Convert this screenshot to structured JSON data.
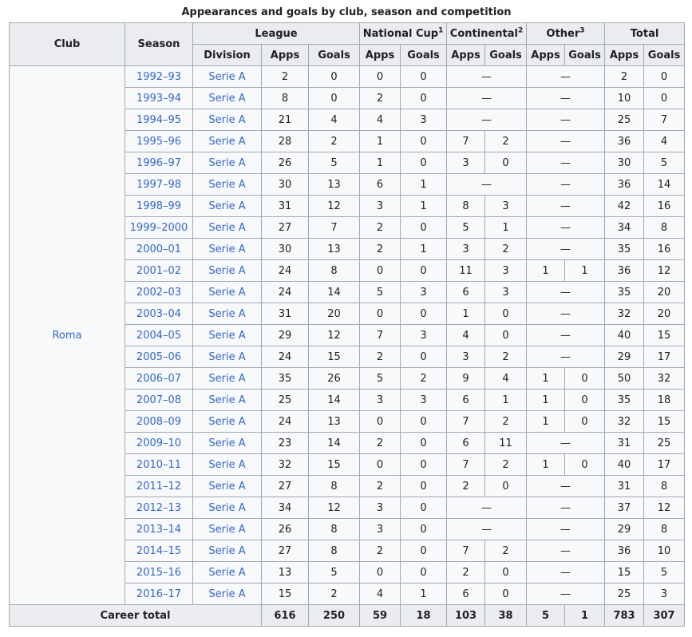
{
  "caption": "Appearances and goals by club, season and competition",
  "headers": {
    "club": "Club",
    "season": "Season",
    "league": "League",
    "national_cup": "National Cup",
    "national_cup_note": "1",
    "continental": "Continental",
    "continental_note": "2",
    "other": "Other",
    "other_note": "3",
    "total": "Total",
    "division": "Division",
    "apps": "Apps",
    "goals": "Goals"
  },
  "club_name": "Roma",
  "dash": "—",
  "rows": [
    {
      "season": "1992–93",
      "division": "Serie A",
      "l_apps": "2",
      "l_goals": "0",
      "c_apps": "0",
      "c_goals": "0",
      "e_apps": null,
      "e_goals": null,
      "o_apps": null,
      "o_goals": null,
      "t_apps": "2",
      "t_goals": "0"
    },
    {
      "season": "1993–94",
      "division": "Serie A",
      "l_apps": "8",
      "l_goals": "0",
      "c_apps": "2",
      "c_goals": "0",
      "e_apps": null,
      "e_goals": null,
      "o_apps": null,
      "o_goals": null,
      "t_apps": "10",
      "t_goals": "0"
    },
    {
      "season": "1994–95",
      "division": "Serie A",
      "l_apps": "21",
      "l_goals": "4",
      "c_apps": "4",
      "c_goals": "3",
      "e_apps": null,
      "e_goals": null,
      "o_apps": null,
      "o_goals": null,
      "t_apps": "25",
      "t_goals": "7"
    },
    {
      "season": "1995–96",
      "division": "Serie A",
      "l_apps": "28",
      "l_goals": "2",
      "c_apps": "1",
      "c_goals": "0",
      "e_apps": "7",
      "e_goals": "2",
      "o_apps": null,
      "o_goals": null,
      "t_apps": "36",
      "t_goals": "4"
    },
    {
      "season": "1996–97",
      "division": "Serie A",
      "l_apps": "26",
      "l_goals": "5",
      "c_apps": "1",
      "c_goals": "0",
      "e_apps": "3",
      "e_goals": "0",
      "o_apps": null,
      "o_goals": null,
      "t_apps": "30",
      "t_goals": "5"
    },
    {
      "season": "1997–98",
      "division": "Serie A",
      "l_apps": "30",
      "l_goals": "13",
      "c_apps": "6",
      "c_goals": "1",
      "e_apps": null,
      "e_goals": null,
      "o_apps": null,
      "o_goals": null,
      "t_apps": "36",
      "t_goals": "14"
    },
    {
      "season": "1998–99",
      "division": "Serie A",
      "l_apps": "31",
      "l_goals": "12",
      "c_apps": "3",
      "c_goals": "1",
      "e_apps": "8",
      "e_goals": "3",
      "o_apps": null,
      "o_goals": null,
      "t_apps": "42",
      "t_goals": "16"
    },
    {
      "season": "1999–2000",
      "division": "Serie A",
      "l_apps": "27",
      "l_goals": "7",
      "c_apps": "2",
      "c_goals": "0",
      "e_apps": "5",
      "e_goals": "1",
      "o_apps": null,
      "o_goals": null,
      "t_apps": "34",
      "t_goals": "8"
    },
    {
      "season": "2000–01",
      "division": "Serie A",
      "l_apps": "30",
      "l_goals": "13",
      "c_apps": "2",
      "c_goals": "1",
      "e_apps": "3",
      "e_goals": "2",
      "o_apps": null,
      "o_goals": null,
      "t_apps": "35",
      "t_goals": "16"
    },
    {
      "season": "2001–02",
      "division": "Serie A",
      "l_apps": "24",
      "l_goals": "8",
      "c_apps": "0",
      "c_goals": "0",
      "e_apps": "11",
      "e_goals": "3",
      "o_apps": "1",
      "o_goals": "1",
      "t_apps": "36",
      "t_goals": "12"
    },
    {
      "season": "2002–03",
      "division": "Serie A",
      "l_apps": "24",
      "l_goals": "14",
      "c_apps": "5",
      "c_goals": "3",
      "e_apps": "6",
      "e_goals": "3",
      "o_apps": null,
      "o_goals": null,
      "t_apps": "35",
      "t_goals": "20"
    },
    {
      "season": "2003–04",
      "division": "Serie A",
      "l_apps": "31",
      "l_goals": "20",
      "c_apps": "0",
      "c_goals": "0",
      "e_apps": "1",
      "e_goals": "0",
      "o_apps": null,
      "o_goals": null,
      "t_apps": "32",
      "t_goals": "20"
    },
    {
      "season": "2004–05",
      "division": "Serie A",
      "l_apps": "29",
      "l_goals": "12",
      "c_apps": "7",
      "c_goals": "3",
      "e_apps": "4",
      "e_goals": "0",
      "o_apps": null,
      "o_goals": null,
      "t_apps": "40",
      "t_goals": "15"
    },
    {
      "season": "2005–06",
      "division": "Serie A",
      "l_apps": "24",
      "l_goals": "15",
      "c_apps": "2",
      "c_goals": "0",
      "e_apps": "3",
      "e_goals": "2",
      "o_apps": null,
      "o_goals": null,
      "t_apps": "29",
      "t_goals": "17"
    },
    {
      "season": "2006–07",
      "division": "Serie A",
      "l_apps": "35",
      "l_goals": "26",
      "c_apps": "5",
      "c_goals": "2",
      "e_apps": "9",
      "e_goals": "4",
      "o_apps": "1",
      "o_goals": "0",
      "t_apps": "50",
      "t_goals": "32"
    },
    {
      "season": "2007–08",
      "division": "Serie A",
      "l_apps": "25",
      "l_goals": "14",
      "c_apps": "3",
      "c_goals": "3",
      "e_apps": "6",
      "e_goals": "1",
      "o_apps": "1",
      "o_goals": "0",
      "t_apps": "35",
      "t_goals": "18"
    },
    {
      "season": "2008–09",
      "division": "Serie A",
      "l_apps": "24",
      "l_goals": "13",
      "c_apps": "0",
      "c_goals": "0",
      "e_apps": "7",
      "e_goals": "2",
      "o_apps": "1",
      "o_goals": "0",
      "t_apps": "32",
      "t_goals": "15"
    },
    {
      "season": "2009–10",
      "division": "Serie A",
      "l_apps": "23",
      "l_goals": "14",
      "c_apps": "2",
      "c_goals": "0",
      "e_apps": "6",
      "e_goals": "11",
      "o_apps": null,
      "o_goals": null,
      "t_apps": "31",
      "t_goals": "25"
    },
    {
      "season": "2010–11",
      "division": "Serie A",
      "l_apps": "32",
      "l_goals": "15",
      "c_apps": "0",
      "c_goals": "0",
      "e_apps": "7",
      "e_goals": "2",
      "o_apps": "1",
      "o_goals": "0",
      "t_apps": "40",
      "t_goals": "17"
    },
    {
      "season": "2011–12",
      "division": "Serie A",
      "l_apps": "27",
      "l_goals": "8",
      "c_apps": "2",
      "c_goals": "0",
      "e_apps": "2",
      "e_goals": "0",
      "o_apps": null,
      "o_goals": null,
      "t_apps": "31",
      "t_goals": "8"
    },
    {
      "season": "2012–13",
      "division": "Serie A",
      "l_apps": "34",
      "l_goals": "12",
      "c_apps": "3",
      "c_goals": "0",
      "e_apps": null,
      "e_goals": null,
      "o_apps": null,
      "o_goals": null,
      "t_apps": "37",
      "t_goals": "12"
    },
    {
      "season": "2013–14",
      "division": "Serie A",
      "l_apps": "26",
      "l_goals": "8",
      "c_apps": "3",
      "c_goals": "0",
      "e_apps": null,
      "e_goals": null,
      "o_apps": null,
      "o_goals": null,
      "t_apps": "29",
      "t_goals": "8"
    },
    {
      "season": "2014–15",
      "division": "Serie A",
      "l_apps": "27",
      "l_goals": "8",
      "c_apps": "2",
      "c_goals": "0",
      "e_apps": "7",
      "e_goals": "2",
      "o_apps": null,
      "o_goals": null,
      "t_apps": "36",
      "t_goals": "10"
    },
    {
      "season": "2015–16",
      "division": "Serie A",
      "l_apps": "13",
      "l_goals": "5",
      "c_apps": "0",
      "c_goals": "0",
      "e_apps": "2",
      "e_goals": "0",
      "o_apps": null,
      "o_goals": null,
      "t_apps": "15",
      "t_goals": "5"
    },
    {
      "season": "2016–17",
      "division": "Serie A",
      "l_apps": "15",
      "l_goals": "2",
      "c_apps": "4",
      "c_goals": "1",
      "e_apps": "6",
      "e_goals": "0",
      "o_apps": null,
      "o_goals": null,
      "t_apps": "25",
      "t_goals": "3"
    }
  ],
  "total_row": {
    "label": "Career total",
    "l_apps": "616",
    "l_goals": "250",
    "c_apps": "59",
    "c_goals": "18",
    "e_apps": "103",
    "e_goals": "38",
    "o_apps": "5",
    "o_goals": "1",
    "t_apps": "783",
    "t_goals": "307"
  }
}
